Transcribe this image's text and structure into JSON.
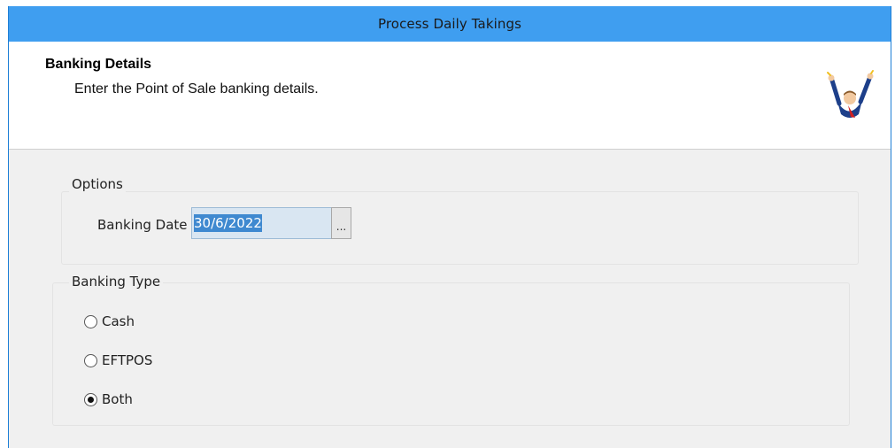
{
  "window": {
    "title": "Process Daily Takings"
  },
  "header": {
    "title": "Banking Details",
    "subtitle": "Enter the Point of Sale banking details.",
    "icon": "wizard-person-icon"
  },
  "options_group": {
    "label": "Options",
    "banking_date_label": "Banking Date",
    "banking_date_value": "30/6/2022",
    "browse_button_label": "..."
  },
  "banking_type_group": {
    "label": "Banking Type",
    "options": [
      {
        "label": "Cash",
        "checked": false
      },
      {
        "label": "EFTPOS",
        "checked": false
      },
      {
        "label": "Both",
        "checked": true
      }
    ]
  },
  "colors": {
    "titlebar": "#3f9ef0",
    "selection": "#3f89d0",
    "window_border": "#1e7fd6"
  }
}
